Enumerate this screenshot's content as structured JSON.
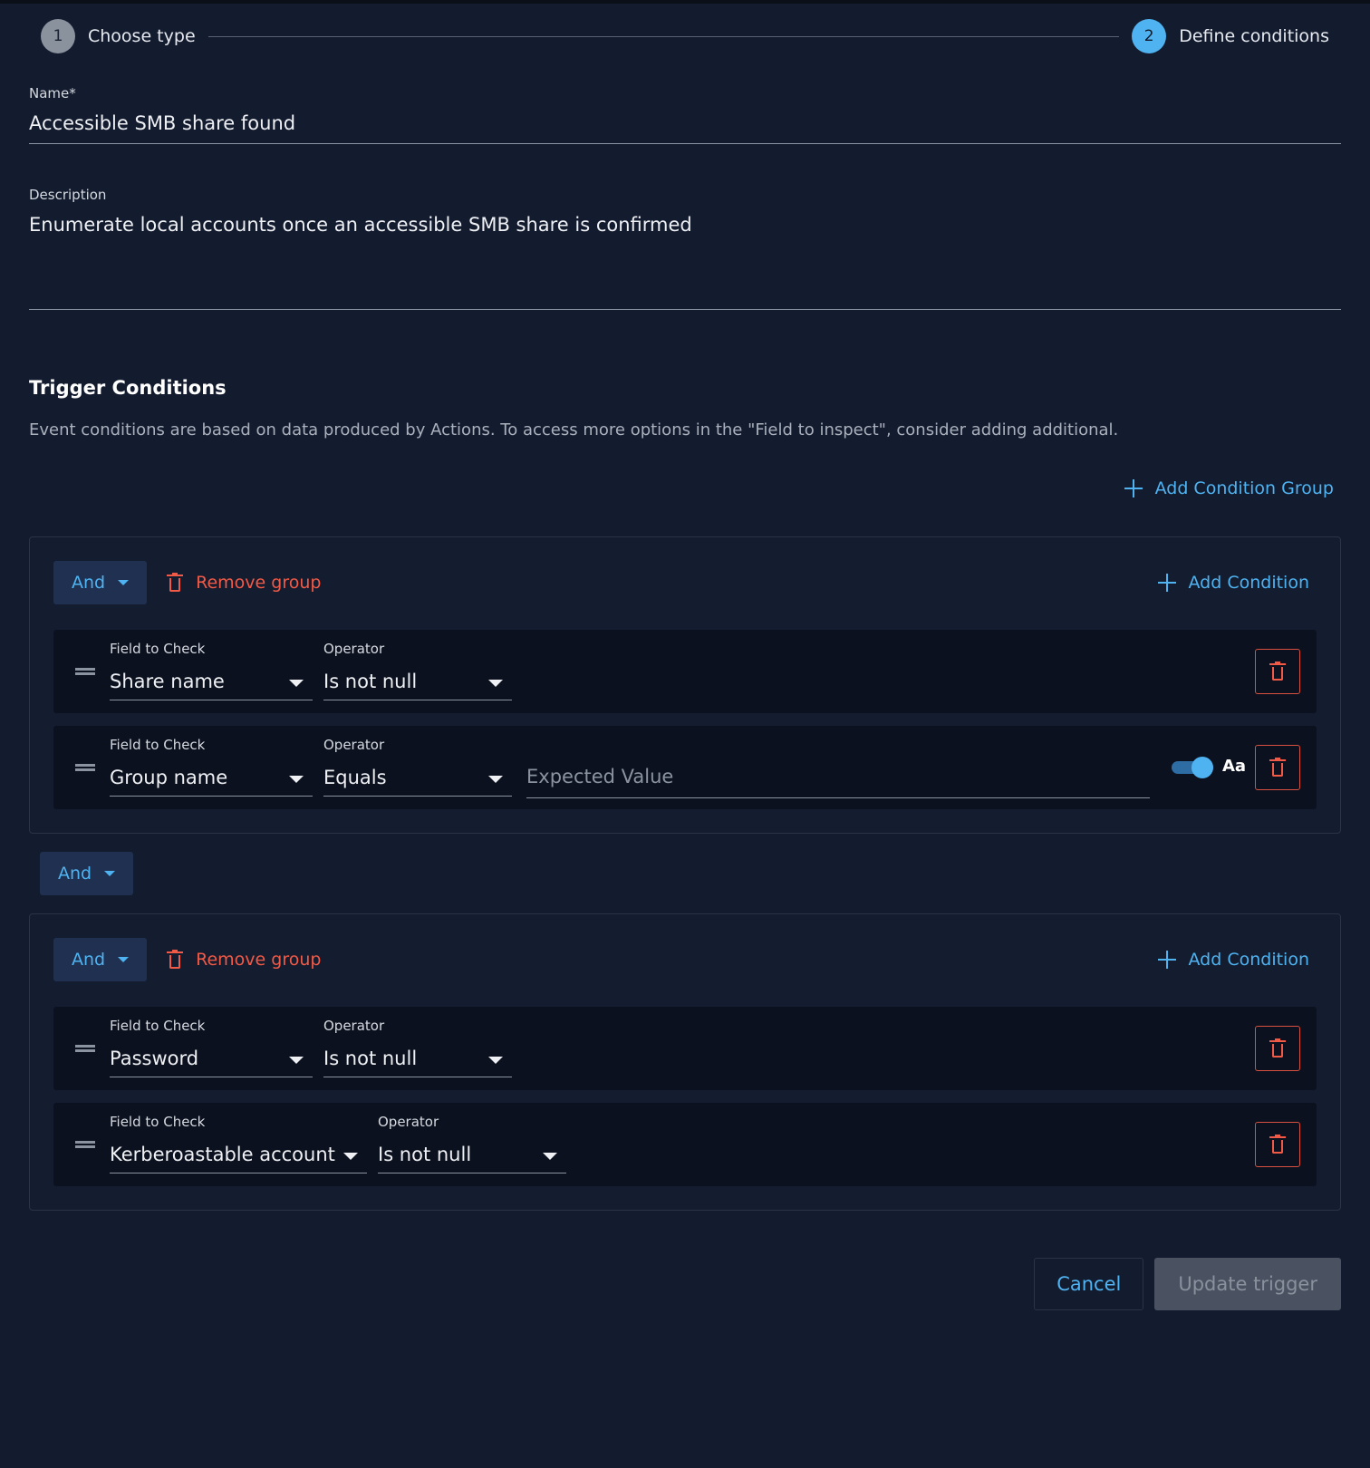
{
  "stepper": {
    "steps": [
      {
        "num": "1",
        "label": "Choose type",
        "state": "done"
      },
      {
        "num": "2",
        "label": "Define conditions",
        "state": "active"
      }
    ]
  },
  "form": {
    "name_label": "Name*",
    "name_value": "Accessible SMB share found",
    "description_label": "Description",
    "description_value": "Enumerate local accounts once an accessible SMB share is confirmed"
  },
  "conditions": {
    "title": "Trigger Conditions",
    "subtitle": "Event conditions are based on data produced by Actions. To access more options in the \"Field to inspect\", consider adding additional.",
    "add_group_label": "Add Condition Group",
    "between_groups_operator": "And",
    "groups": [
      {
        "operator": "And",
        "remove_label": "Remove group",
        "add_condition_label": "Add Condition",
        "rows": [
          {
            "field_label": "Field to Check",
            "field_value": "Share name",
            "operator_label": "Operator",
            "operator_value": "Is not null"
          },
          {
            "field_label": "Field to Check",
            "field_value": "Group name",
            "operator_label": "Operator",
            "operator_value": "Equals",
            "value_placeholder": "Expected Value",
            "case_sensitive_label": "Aa",
            "case_sensitive_on": true
          }
        ]
      },
      {
        "operator": "And",
        "remove_label": "Remove group",
        "add_condition_label": "Add Condition",
        "rows": [
          {
            "field_label": "Field to Check",
            "field_value": "Password",
            "operator_label": "Operator",
            "operator_value": "Is not null"
          },
          {
            "field_label": "Field to Check",
            "field_value": "Kerberoastable account",
            "operator_label": "Operator",
            "operator_value": "Is not null"
          }
        ]
      }
    ]
  },
  "footer": {
    "cancel_label": "Cancel",
    "update_label": "Update trigger"
  },
  "colors": {
    "background": "#131b2e",
    "accent": "#4fb3f1",
    "danger": "#f05a47",
    "row_bg": "#0b111e"
  },
  "icons": [
    "plus-icon",
    "trash-icon",
    "drag-handle-icon",
    "caret-down-icon"
  ]
}
